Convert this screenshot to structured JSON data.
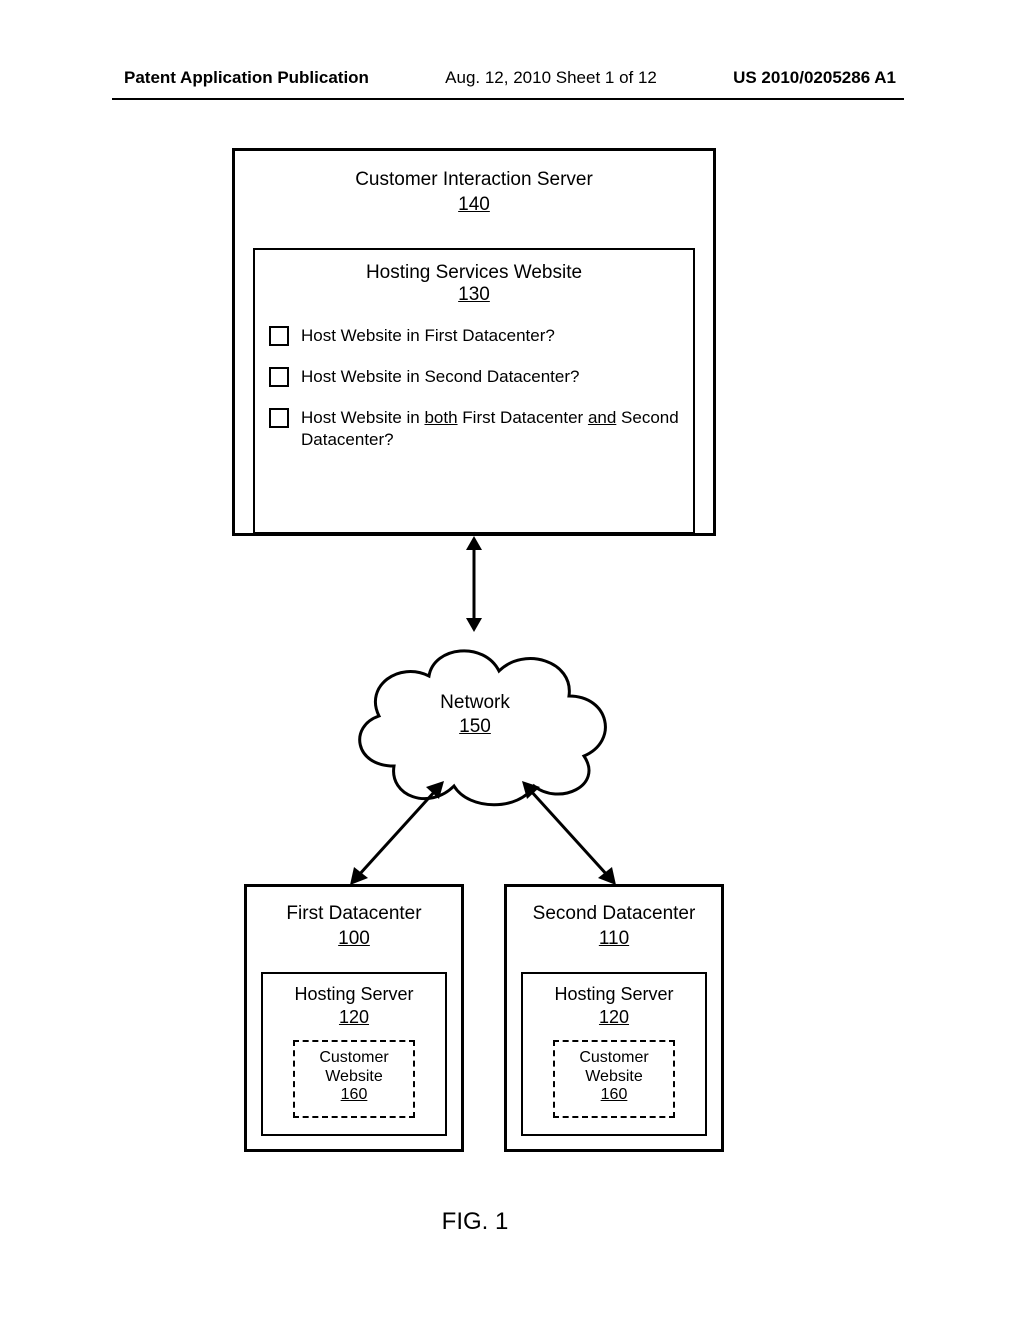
{
  "header": {
    "left": "Patent Application Publication",
    "mid": "Aug. 12, 2010  Sheet 1 of 12",
    "right": "US 2010/0205286 A1"
  },
  "server": {
    "title": "Customer Interaction Server",
    "ref": "140"
  },
  "website": {
    "title": "Hosting Services Website",
    "ref": "130",
    "options": [
      "Host Website in First Datacenter?",
      "Host Website in Second Datacenter?"
    ],
    "option3_pre": "Host Website in ",
    "option3_u1": "both",
    "option3_mid": " First Datacenter ",
    "option3_u2": "and",
    "option3_post": " Second Datacenter?"
  },
  "network": {
    "label": "Network",
    "ref": "150"
  },
  "dc": {
    "first": {
      "title": "First Datacenter",
      "ref": "100"
    },
    "second": {
      "title": "Second Datacenter",
      "ref": "110"
    },
    "hosting": {
      "title": "Hosting Server",
      "ref": "120"
    },
    "customer": {
      "line1": "Customer",
      "line2": "Website",
      "ref": "160"
    }
  },
  "figure": "FIG. 1"
}
